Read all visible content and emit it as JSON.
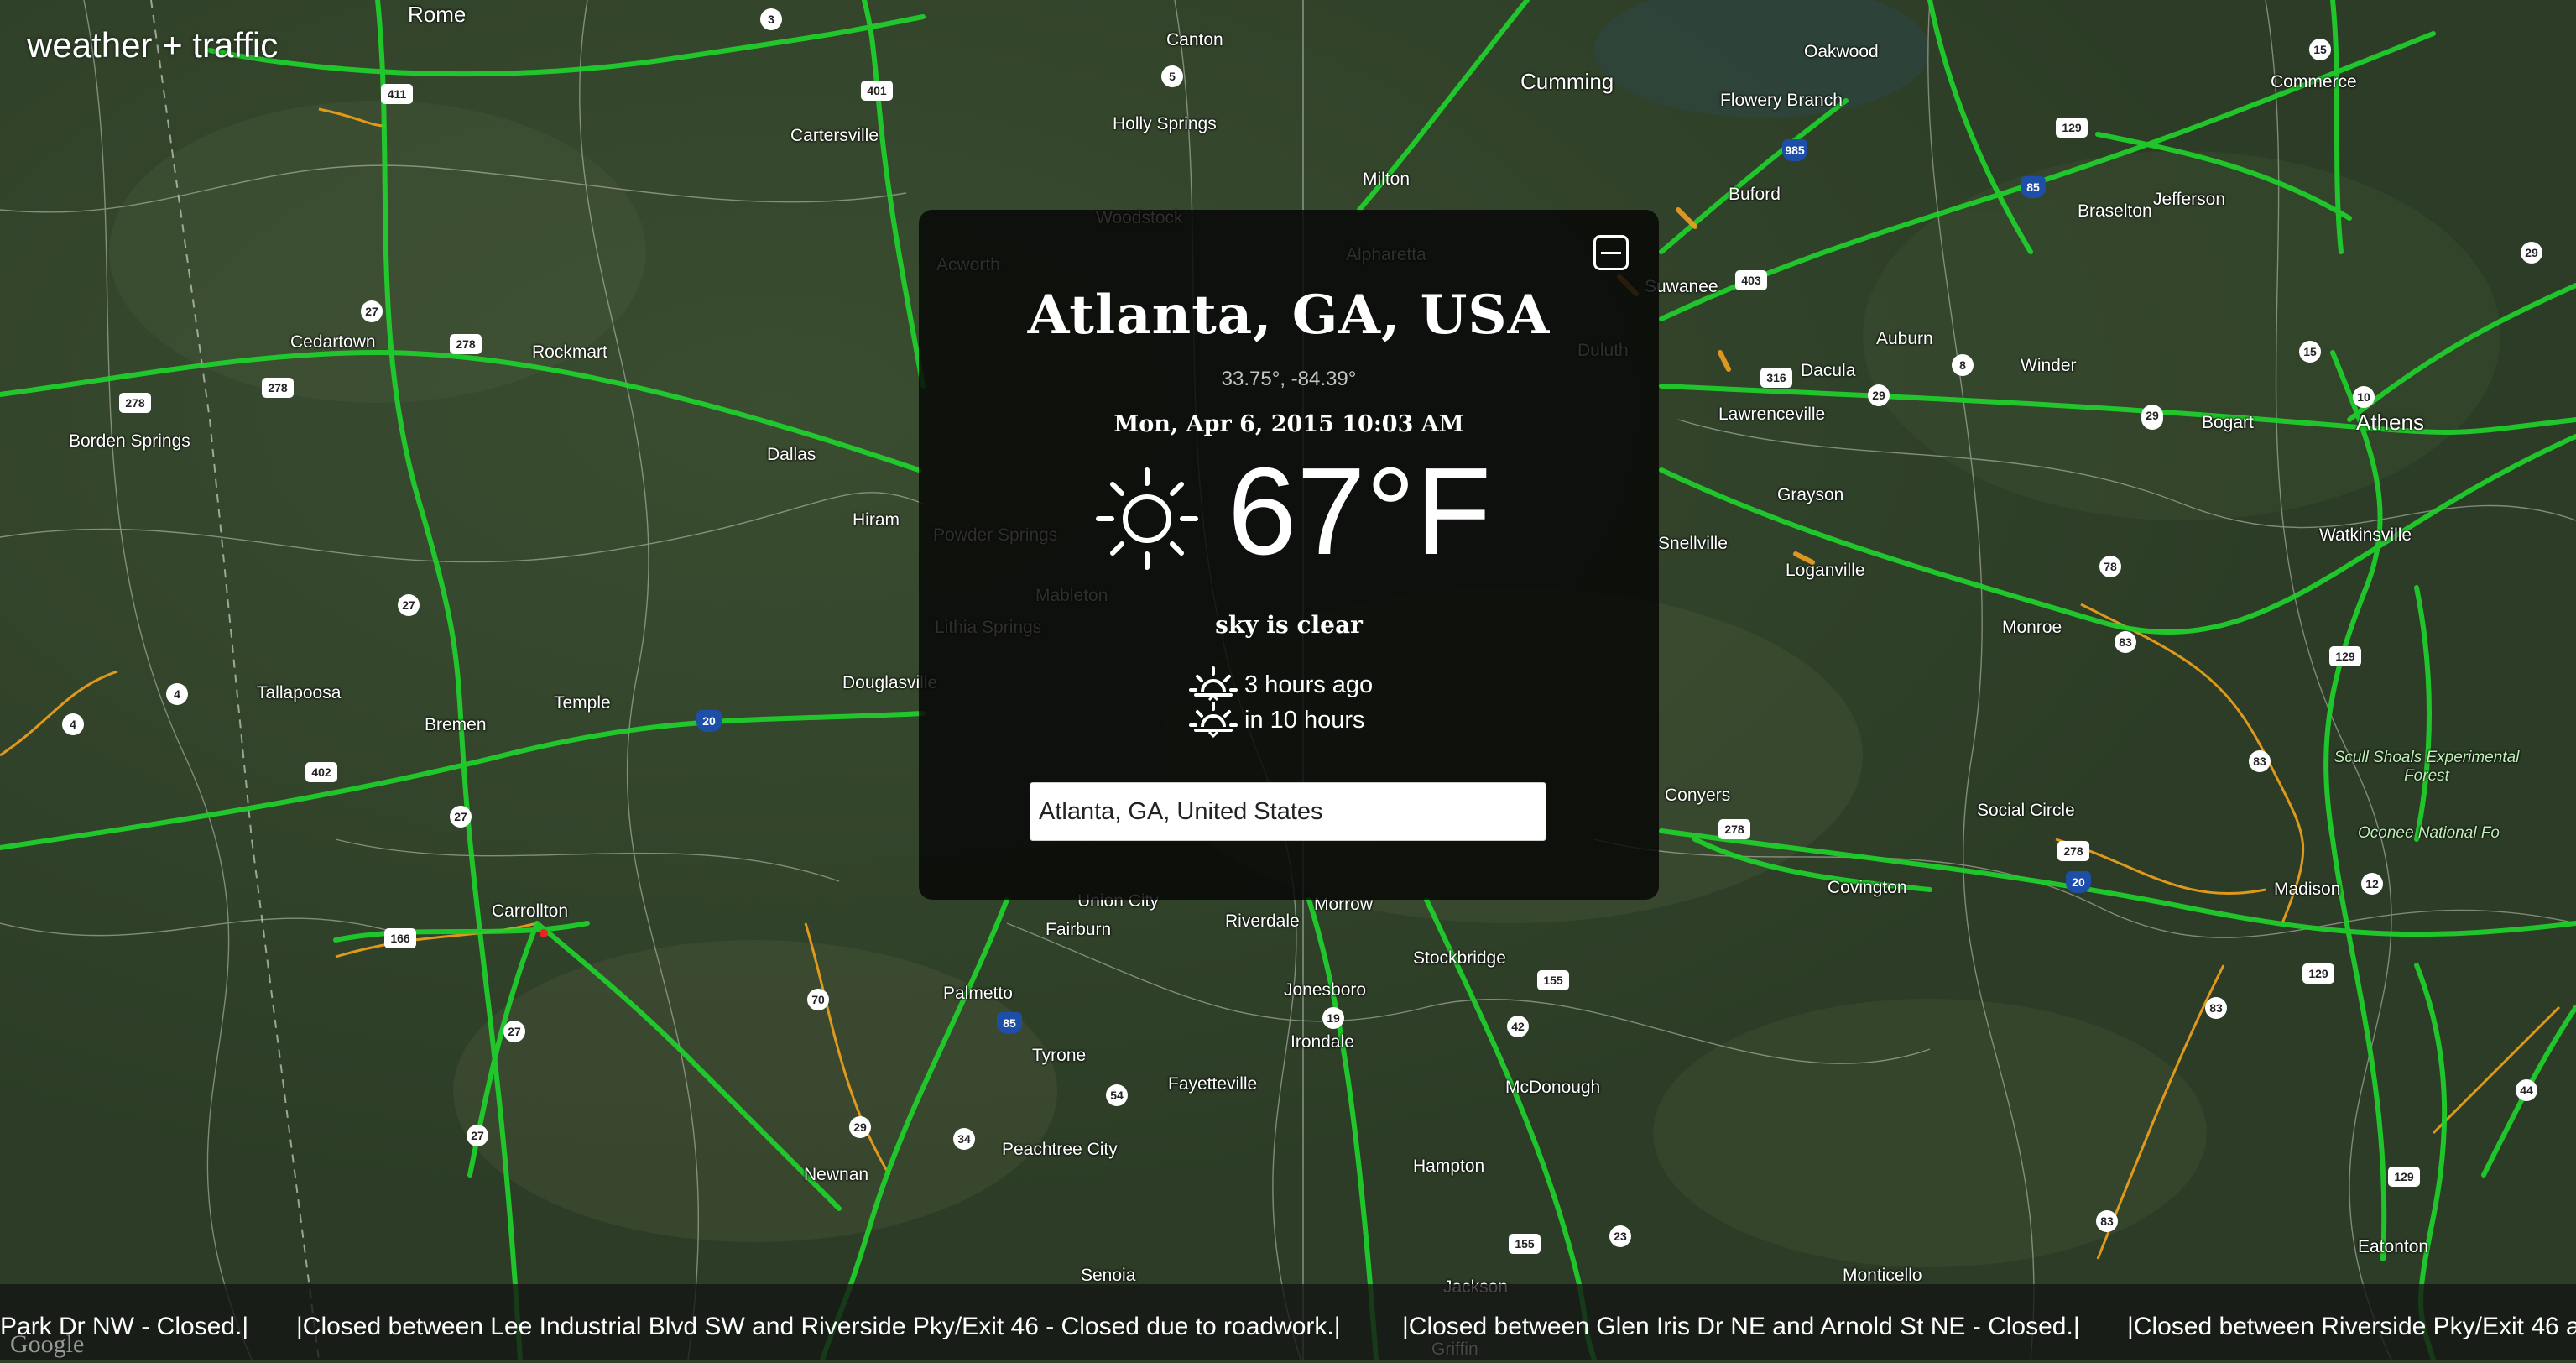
{
  "app": {
    "logo_text": "weather + traffic"
  },
  "map": {
    "places": [
      {
        "name": "Rome",
        "cls": "big"
      },
      {
        "name": "Canton",
        "cls": ""
      },
      {
        "name": "Cumming",
        "cls": "big"
      },
      {
        "name": "Oakwood",
        "cls": ""
      },
      {
        "name": "Flowery Branch",
        "cls": ""
      },
      {
        "name": "Commerce",
        "cls": ""
      },
      {
        "name": "Cartersville",
        "cls": ""
      },
      {
        "name": "Holly Springs",
        "cls": ""
      },
      {
        "name": "Milton",
        "cls": ""
      },
      {
        "name": "Buford",
        "cls": ""
      },
      {
        "name": "Braselton",
        "cls": ""
      },
      {
        "name": "Jefferson",
        "cls": ""
      },
      {
        "name": "Woodstock",
        "cls": ""
      },
      {
        "name": "Alpharetta",
        "cls": ""
      },
      {
        "name": "Acworth",
        "cls": ""
      },
      {
        "name": "Suwanee",
        "cls": ""
      },
      {
        "name": "Cedartown",
        "cls": ""
      },
      {
        "name": "Rockmart",
        "cls": ""
      },
      {
        "name": "Duluth",
        "cls": ""
      },
      {
        "name": "Auburn",
        "cls": ""
      },
      {
        "name": "Winder",
        "cls": ""
      },
      {
        "name": "Dacula",
        "cls": ""
      },
      {
        "name": "Lawrenceville",
        "cls": ""
      },
      {
        "name": "Borden Springs",
        "cls": ""
      },
      {
        "name": "Bogart",
        "cls": ""
      },
      {
        "name": "Athens",
        "cls": "big"
      },
      {
        "name": "Dallas",
        "cls": ""
      },
      {
        "name": "Hiram",
        "cls": ""
      },
      {
        "name": "Grayson",
        "cls": ""
      },
      {
        "name": "Snellville",
        "cls": ""
      },
      {
        "name": "Watkinsville",
        "cls": ""
      },
      {
        "name": "Loganville",
        "cls": ""
      },
      {
        "name": "Powder Springs",
        "cls": ""
      },
      {
        "name": "Mableton",
        "cls": ""
      },
      {
        "name": "Monroe",
        "cls": ""
      },
      {
        "name": "Lithia Springs",
        "cls": ""
      },
      {
        "name": "Tallapoosa",
        "cls": ""
      },
      {
        "name": "Temple",
        "cls": ""
      },
      {
        "name": "Douglasville",
        "cls": ""
      },
      {
        "name": "Bremen",
        "cls": ""
      },
      {
        "name": "Conyers",
        "cls": ""
      },
      {
        "name": "Social Circle",
        "cls": ""
      },
      {
        "name": "Covington",
        "cls": ""
      },
      {
        "name": "Madison",
        "cls": ""
      },
      {
        "name": "Carrollton",
        "cls": ""
      },
      {
        "name": "Union City",
        "cls": ""
      },
      {
        "name": "Fairburn",
        "cls": ""
      },
      {
        "name": "Riverdale",
        "cls": ""
      },
      {
        "name": "Morrow",
        "cls": ""
      },
      {
        "name": "Stockbridge",
        "cls": ""
      },
      {
        "name": "Palmetto",
        "cls": ""
      },
      {
        "name": "Jonesboro",
        "cls": ""
      },
      {
        "name": "Tyrone",
        "cls": ""
      },
      {
        "name": "Irondale",
        "cls": ""
      },
      {
        "name": "Fayetteville",
        "cls": ""
      },
      {
        "name": "McDonough",
        "cls": ""
      },
      {
        "name": "Peachtree City",
        "cls": ""
      },
      {
        "name": "Newnan",
        "cls": ""
      },
      {
        "name": "Hampton",
        "cls": ""
      },
      {
        "name": "Senoia",
        "cls": ""
      },
      {
        "name": "Monticello",
        "cls": ""
      },
      {
        "name": "Eatonton",
        "cls": ""
      },
      {
        "name": "Jackson",
        "cls": ""
      },
      {
        "name": "Griffin",
        "cls": ""
      },
      {
        "name": "Scull Shoals Experimental Forest",
        "cls": "park"
      },
      {
        "name": "Oconee National Fo",
        "cls": "park"
      }
    ],
    "shields": [
      "3",
      "411",
      "5",
      "401",
      "15",
      "129",
      "985",
      "85",
      "29",
      "27",
      "278",
      "278",
      "278",
      "403",
      "316",
      "29",
      "8",
      "15",
      "10",
      "78",
      "29",
      "278",
      "4",
      "4",
      "20",
      "402",
      "27",
      "166",
      "70",
      "85",
      "27",
      "54",
      "34",
      "29",
      "27",
      "19",
      "155",
      "42",
      "155",
      "23",
      "83",
      "83",
      "129",
      "129",
      "83",
      "83",
      "44",
      "129",
      "12",
      "20",
      "278",
      "78",
      "27"
    ]
  },
  "weather": {
    "collapse_icon": "minus-square-icon",
    "location": "Atlanta, GA, USA",
    "coordinates": "33.75°, -84.39°",
    "datetime": "Mon, Apr 6, 2015 10:03 AM",
    "condition_icon": "sun-icon",
    "temperature": "67°F",
    "condition": "sky is clear",
    "sunrise_icon": "sunrise-icon",
    "sunrise": "3 hours ago",
    "sunset_icon": "sunset-icon",
    "sunset": "in 10 hours",
    "search_value": "Atlanta, GA, United States"
  },
  "traffic": {
    "ticker": [
      "Park Dr NW - Closed.|",
      "|Closed between Lee Industrial Blvd SW and Riverside Pky/Exit 46 - Closed due to roadwork.|",
      "|Closed between Glen Iris Dr NE and Arnold St NE - Closed.|",
      "|Closed between Riverside Pky/Exit 46 a"
    ]
  },
  "attribution": {
    "google": "Google"
  },
  "colors": {
    "map_base": "#2f4029",
    "traffic_green": "#1fd12c",
    "traffic_yellow": "#f2a31b",
    "panel_bg": "rgba(6,6,6,0.84)"
  }
}
